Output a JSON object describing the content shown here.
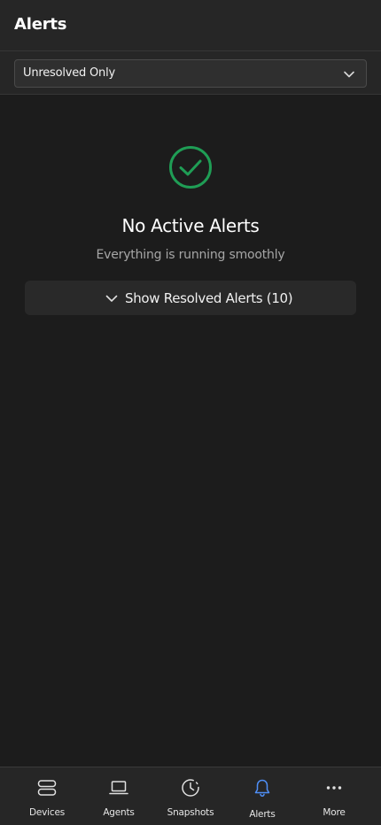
{
  "header": {
    "title": "Alerts"
  },
  "filter": {
    "selected": "Unresolved Only",
    "chevron_icon": "chevron-down-icon"
  },
  "empty_state": {
    "icon": "check-circle-icon",
    "icon_color": "#1f9d55",
    "title": "No Active Alerts",
    "subtitle": "Everything is running smoothly"
  },
  "resolved_toggle": {
    "label": "Show Resolved Alerts (10)",
    "icon": "chevron-down-icon"
  },
  "tabbar": {
    "active_color": "#4f8ff7",
    "items": [
      {
        "label": "Devices",
        "icon": "server-icon",
        "active": false
      },
      {
        "label": "Agents",
        "icon": "laptop-icon",
        "active": false
      },
      {
        "label": "Snapshots",
        "icon": "clock-icon",
        "active": false
      },
      {
        "label": "Alerts",
        "icon": "bell-icon",
        "active": true
      },
      {
        "label": "More",
        "icon": "more-dots-icon",
        "active": false
      }
    ]
  }
}
